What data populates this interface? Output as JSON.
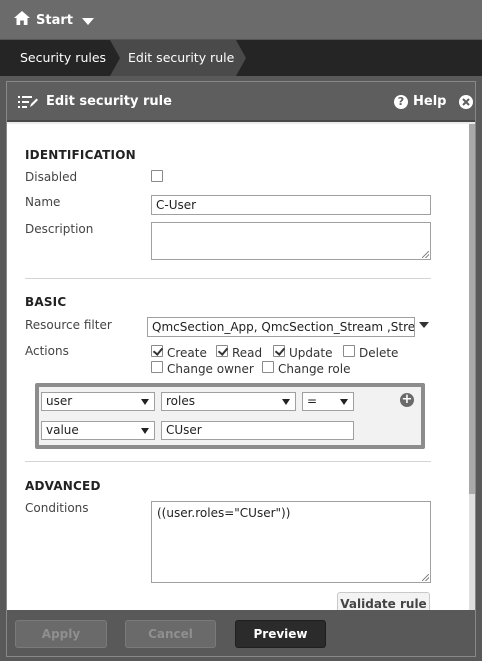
{
  "topbar": {
    "start_label": "Start",
    "start_icon": "home-icon"
  },
  "breadcrumb": {
    "items": [
      "Security rules",
      "Edit security rule"
    ]
  },
  "dialog": {
    "title": "Edit security rule",
    "help_label": "Help",
    "identification": {
      "section_title": "IDENTIFICATION",
      "disabled_label": "Disabled",
      "disabled_checked": false,
      "name_label": "Name",
      "name_value": "C-User",
      "description_label": "Description",
      "description_value": ""
    },
    "basic": {
      "section_title": "BASIC",
      "resource_filter_label": "Resource filter",
      "resource_filter_value": "QmcSection_App, QmcSection_Stream ,Stre",
      "actions_label": "Actions",
      "actions": [
        {
          "label": "Create",
          "checked": true
        },
        {
          "label": "Read",
          "checked": true
        },
        {
          "label": "Update",
          "checked": true
        },
        {
          "label": "Delete",
          "checked": false
        },
        {
          "label": "Change owner",
          "checked": false
        },
        {
          "label": "Change role",
          "checked": false
        }
      ],
      "builder": {
        "row1": {
          "subject": "user",
          "property": "roles",
          "operator": "="
        },
        "row2": {
          "type": "value",
          "value": "CUser"
        }
      }
    },
    "advanced": {
      "section_title": "ADVANCED",
      "conditions_label": "Conditions",
      "conditions_value": "((user.roles=\"CUser\"))",
      "validate_label": "Validate rule"
    },
    "footer": {
      "apply_label": "Apply",
      "cancel_label": "Cancel",
      "preview_label": "Preview"
    }
  }
}
